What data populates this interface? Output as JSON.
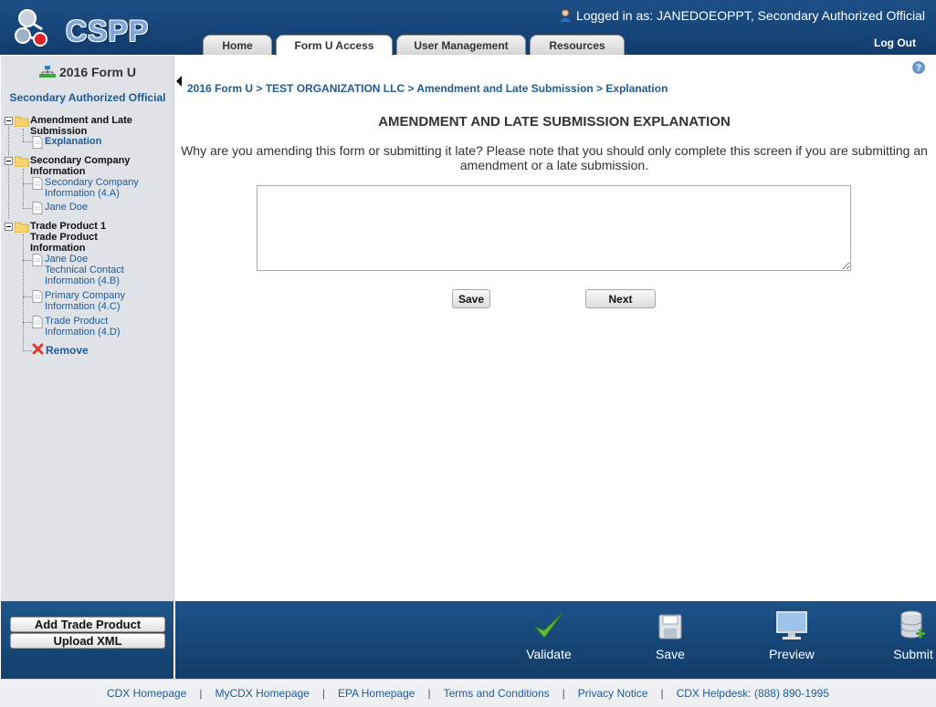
{
  "header": {
    "app_name": "CSPP",
    "login_prefix": "Logged in as:",
    "login_user": "JANEDOEOPPT, Secondary Authorized Official",
    "logout": "Log Out"
  },
  "tabs": [
    {
      "label": "Home",
      "active": false
    },
    {
      "label": "Form U Access",
      "active": true
    },
    {
      "label": "User Management",
      "active": false
    },
    {
      "label": "Resources",
      "active": false
    }
  ],
  "sidebar": {
    "title": "2016 Form U",
    "role": "Secondary Authorized Official",
    "tree": {
      "amendment_folder": "Amendment and Late Submission",
      "explanation": "Explanation",
      "secondary_folder": "Secondary Company Information",
      "secondary_info": "Secondary Company Information (4.A)",
      "jane_doe": "Jane Doe",
      "trade_folder": "Trade Product 1 Trade Product Information",
      "technical_contact": "Jane Doe Technical Contact Information (4.B)",
      "primary_company": "Primary Company Information (4.C)",
      "trade_info": "Trade Product Information (4.D)",
      "remove": "Remove"
    }
  },
  "breadcrumb": "2016 Form U > TEST ORGANIZATION LLC > Amendment and Late Submission > Explanation",
  "main": {
    "title": "AMENDMENT AND LATE SUBMISSION EXPLANATION",
    "instructions": "Why are you amending this form or submitting it late? Please note that you should only complete this screen if you are submitting an amendment or a late submission.",
    "explanation_value": "",
    "save_label": "Save",
    "next_label": "Next"
  },
  "footer": {
    "add_trade_product": "Add Trade Product",
    "upload_xml": "Upload XML",
    "validate": "Validate",
    "save": "Save",
    "preview": "Preview",
    "submit": "Submit"
  },
  "bottom_links": [
    "CDX Homepage",
    "MyCDX Homepage",
    "EPA Homepage",
    "Terms and Conditions",
    "Privacy Notice",
    "CDX Helpdesk: (888) 890-1995"
  ],
  "colors": {
    "header_blue": "#1d4f86",
    "link_blue": "#1f5a99",
    "sidebar_bg": "#dfe2e6",
    "validate_green": "#3aa33a",
    "remove_red": "#e03a2a"
  }
}
